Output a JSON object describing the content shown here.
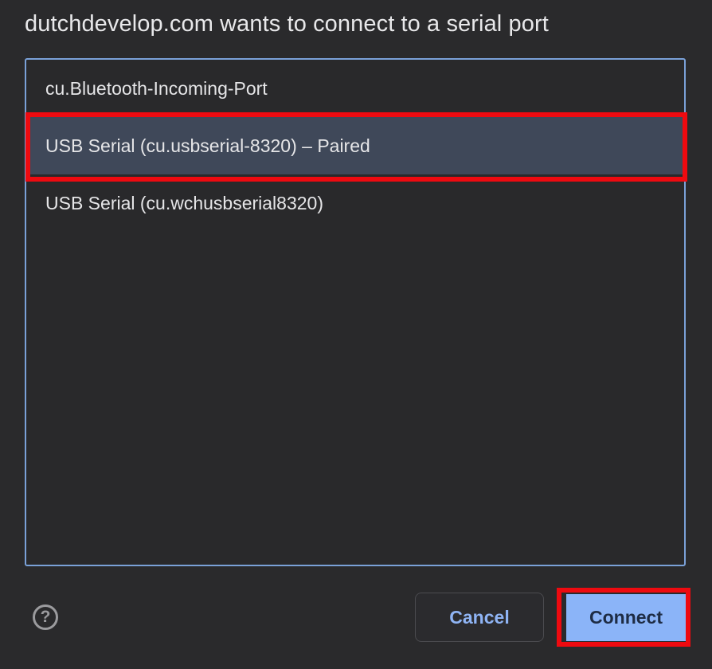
{
  "dialog": {
    "title": "dutchdevelop.com wants to connect to a serial port"
  },
  "ports": [
    {
      "label": "cu.Bluetooth-Incoming-Port",
      "selected": false
    },
    {
      "label": "USB Serial (cu.usbserial-8320) – Paired",
      "selected": true
    },
    {
      "label": "USB Serial (cu.wchusbserial8320)",
      "selected": false
    }
  ],
  "footer": {
    "help_icon": "question-circle-icon",
    "help_glyph": "?",
    "cancel_label": "Cancel",
    "connect_label": "Connect"
  },
  "colors": {
    "background": "#2a2a2c",
    "list_border": "#7aa1d8",
    "selected_row": "#3f4859",
    "highlight_annotation": "#ee0a10",
    "primary_button": "#8bb4f8",
    "cancel_text": "#8fb4f4"
  }
}
